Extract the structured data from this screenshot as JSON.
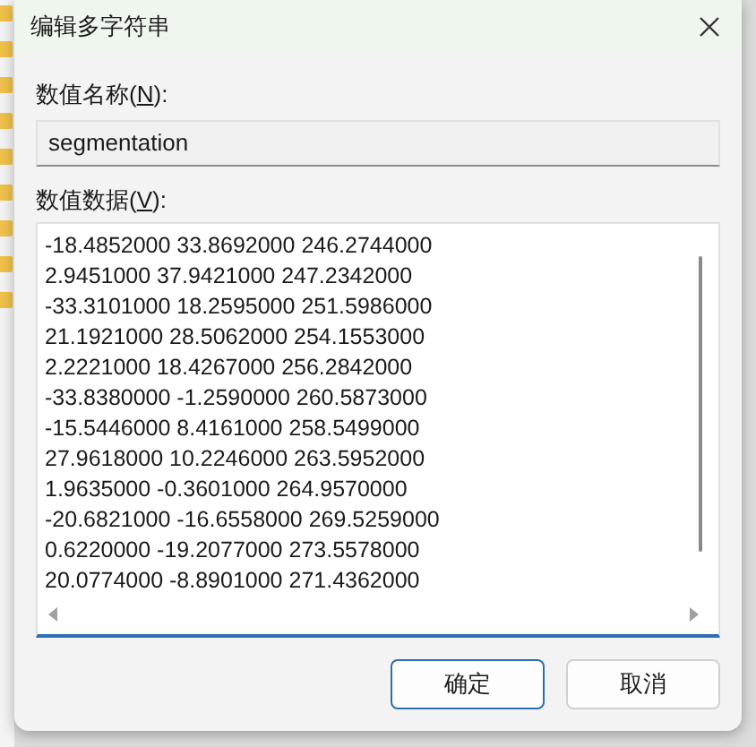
{
  "window": {
    "title": "编辑多字符串"
  },
  "name_field": {
    "label": {
      "before": "数值名称(",
      "mnemonic": "N",
      "after": "):"
    },
    "value": "segmentation"
  },
  "data_field": {
    "label": {
      "before": "数值数据(",
      "mnemonic": "V",
      "after": "):"
    },
    "lines": [
      "-18.4852000 33.8692000 246.2744000",
      "2.9451000 37.9421000 247.2342000",
      "-33.3101000 18.2595000 251.5986000",
      "21.1921000 28.5062000 254.1553000",
      "2.2221000 18.4267000 256.2842000",
      "-33.8380000 -1.2590000 260.5873000",
      "-15.5446000 8.4161000 258.5499000",
      "27.9618000 10.2246000 263.5952000",
      "1.9635000 -0.3601000 264.9570000",
      "-20.6821000 -16.6558000 269.5259000",
      "0.6220000 -19.2077000 273.5578000",
      "20.0774000 -8.8901000 271.4362000"
    ]
  },
  "buttons": [
    {
      "label": "确定",
      "default": true
    },
    {
      "label": "取消",
      "default": false
    }
  ]
}
